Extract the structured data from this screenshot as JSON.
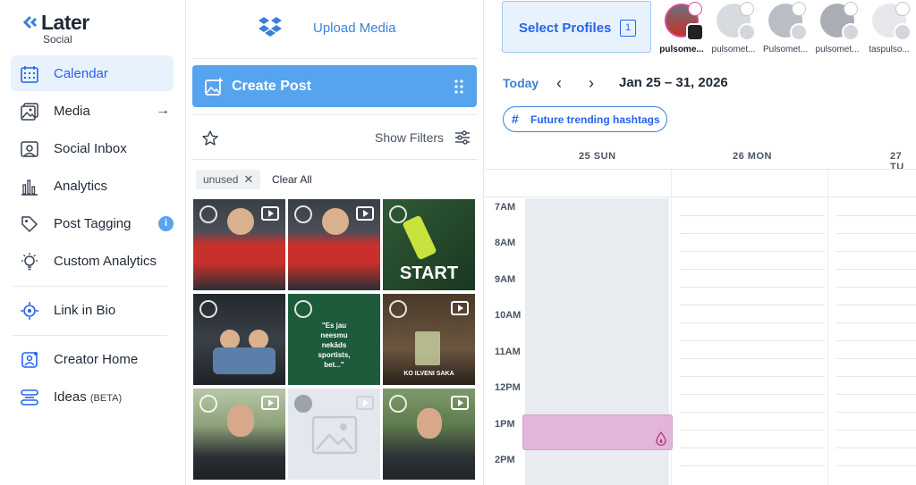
{
  "brand": {
    "name": "Later",
    "sub": "Social"
  },
  "sidebar": {
    "items": [
      {
        "label": "Calendar",
        "icon": "calendar-icon",
        "active": true
      },
      {
        "label": "Media",
        "icon": "media-icon",
        "arrow": "→"
      },
      {
        "label": "Social Inbox",
        "icon": "inbox-icon"
      },
      {
        "label": "Analytics",
        "icon": "analytics-icon"
      },
      {
        "label": "Post Tagging",
        "icon": "tag-icon",
        "info": "i"
      },
      {
        "label": "Custom Analytics",
        "icon": "lightbulb-icon"
      },
      {
        "label": "Link in Bio",
        "icon": "link-in-bio-icon"
      },
      {
        "label": "Creator Home",
        "icon": "creator-home-icon"
      },
      {
        "label": "Ideas",
        "badge": "(BETA)",
        "icon": "ideas-icon"
      }
    ]
  },
  "media": {
    "upload_label": "Upload Media",
    "create_post_label": "Create Post",
    "show_filters_label": "Show Filters",
    "filter_chip": "unused",
    "clear_all_label": "Clear All",
    "tile_texts": {
      "start": "START",
      "quote": "\"Es jau\nneesmu\nnekāds\nsportists,\nbet...\"",
      "bar": "KO ILVENI SAKA"
    }
  },
  "calendar": {
    "select_profiles_label": "Select Profiles",
    "selected_count": "1",
    "profiles": [
      {
        "name": "pulsome...",
        "network": "instagram-icon",
        "selected": true
      },
      {
        "name": "pulsomet...",
        "network": "facebook-icon"
      },
      {
        "name": "Pulsomet...",
        "network": "twitter-icon"
      },
      {
        "name": "pulsomet...",
        "network": "tiktok-icon"
      },
      {
        "name": "taspulso...",
        "network": "youtube-icon"
      }
    ],
    "today_label": "Today",
    "date_range": "Jan 25 – 31, 2026",
    "hashtags_label": "Future trending hashtags",
    "days": [
      "25 SUN",
      "26 MON",
      "27 TU"
    ],
    "hours": [
      "7AM",
      "8AM",
      "9AM",
      "10AM",
      "11AM",
      "12PM",
      "1PM",
      "2PM"
    ]
  },
  "colors": {
    "accent": "#2563eb",
    "create_post": "#57a4ee",
    "event": "#e3b5d8",
    "active_nav": "#e8f2fd"
  }
}
